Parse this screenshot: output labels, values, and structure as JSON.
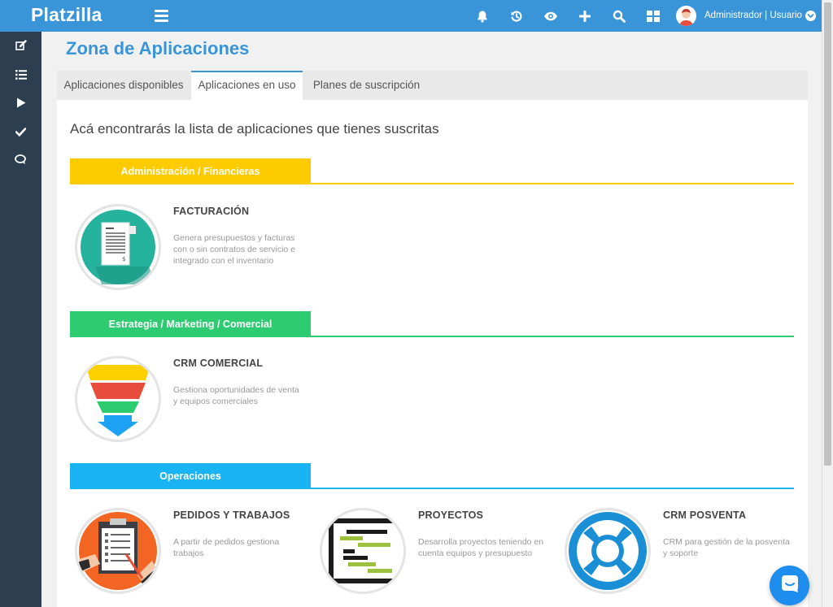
{
  "header": {
    "logo": "Platzilla",
    "icons": [
      "bell-icon",
      "history-icon",
      "eye-icon",
      "plus-icon",
      "search-icon",
      "grid-icon"
    ],
    "user_label": "Administrador | Usuario"
  },
  "sidebar": {
    "items": [
      "edit-icon",
      "list-icon",
      "play-icon",
      "check-icon",
      "chat-icon"
    ]
  },
  "page": {
    "title": "Zona de Aplicaciones",
    "tabs": [
      "Aplicaciones disponibles",
      "Aplicaciones en uso",
      "Planes de suscripción"
    ],
    "active_tab": "Aplicaciones en uso",
    "intro": "Acá encontrarás la lista de aplicaciones que tienes suscritas"
  },
  "categories": [
    {
      "name": "Administración / Financieras",
      "color": "#fdcb00",
      "apps": [
        {
          "title": "FACTURACIÓN",
          "desc": "Genera presupuestos y facturas con o sin contratos de servicio e integrado con el inventario",
          "icon": "invoice-icon"
        }
      ]
    },
    {
      "name": "Estrategia / Marketing / Comercial",
      "color": "#2ecc71",
      "apps": [
        {
          "title": "CRM COMERCIAL",
          "desc": "Gestiona oportunidades de venta y equipos comerciales",
          "icon": "funnel-icon"
        }
      ]
    },
    {
      "name": "Operaciones",
      "color": "#1ab4f5",
      "apps": [
        {
          "title": "PEDIDOS Y TRABAJOS",
          "desc": "A partir de pedidos gestiona trabajos",
          "icon": "clipboard-icon"
        },
        {
          "title": "PROYECTOS",
          "desc": "Desarrolla proyectos teniendo en cuenta equipos y presupuesto",
          "icon": "gantt-icon"
        },
        {
          "title": "CRM POSVENTA",
          "desc": "CRM para gestión de la posventa y soporte",
          "icon": "lifebuoy-icon"
        }
      ]
    }
  ],
  "colors": {
    "topbar": "#3a95d8",
    "sidebar": "#2c3e50",
    "title": "#3a95d8"
  }
}
